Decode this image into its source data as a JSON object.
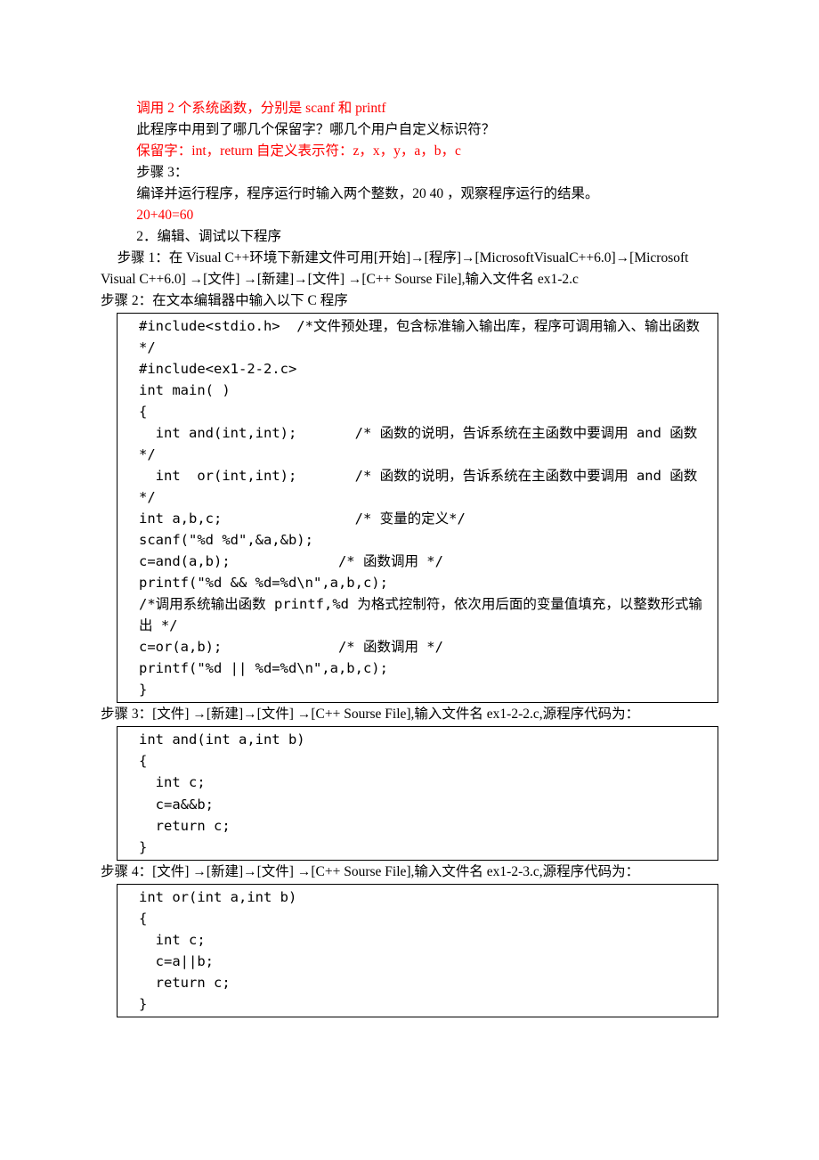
{
  "p1": "调用 2 个系统函数，分别是 scanf 和 printf",
  "p2": "此程序中用到了哪几个保留字？哪几个用户自定义标识符？",
  "p3": "保留字：int，return 自定义表示符：z，x，y，a，b，c",
  "p4": "步骤 3：",
  "p5": "编译并运行程序，程序运行时输入两个整数，20    40 ，观察程序运行的结果。",
  "p6": "20+40=60",
  "p7": "2．编辑、调试以下程序",
  "p8": "步骤 1：在 Visual C++环境下新建文件可用[开始]→[程序]→[MicrosoftVisualC++6.0]→[Microsoft Visual C++6.0] →[文件] →[新建]→[文件] →[C++ Sourse File],输入文件名 ex1-2.c",
  "p9": "步骤 2：在文本编辑器中输入以下 C 程序",
  "code1": [
    "#include<stdio.h>  /*文件预处理，包含标准输入输出库，程序可调用输入、输出函数*/",
    "#include<ex1-2-2.c>",
    "int main( )",
    "{",
    "  int and(int,int);       /* 函数的说明，告诉系统在主函数中要调用 and 函数 */",
    "  int  or(int,int);       /* 函数的说明，告诉系统在主函数中要调用 and 函数 */",
    "int a,b,c;                /* 变量的定义*/",
    "scanf(\"%d %d\",&a,&b);",
    "c=and(a,b);             /* 函数调用 */",
    "printf(\"%d && %d=%d\\n\",a,b,c);",
    "/*调用系统输出函数 printf,%d 为格式控制符，依次用后面的变量值填充，以整数形式输出 */",
    "c=or(a,b);              /* 函数调用 */",
    "printf(\"%d || %d=%d\\n\",a,b,c);",
    "}"
  ],
  "p10": "步骤 3：[文件] →[新建]→[文件] →[C++ Sourse File],输入文件名 ex1-2-2.c,源程序代码为：",
  "code2": [
    "int and(int a,int b)",
    "{",
    "  int c;",
    "  c=a&&b;",
    "  return c;",
    "}"
  ],
  "p11": "步骤 4：[文件] →[新建]→[文件] →[C++ Sourse File],输入文件名 ex1-2-3.c,源程序代码为：",
  "code3": [
    "int or(int a,int b)",
    "{",
    "  int c;",
    "  c=a||b;",
    "  return c;",
    "}"
  ]
}
